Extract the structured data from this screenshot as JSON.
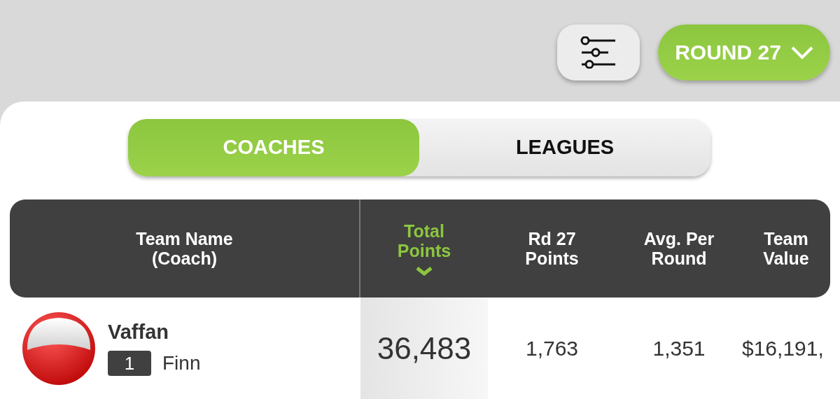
{
  "round_button": {
    "label": "ROUND 27"
  },
  "tabs": [
    {
      "label": "COACHES",
      "selected": true
    },
    {
      "label": "LEAGUES",
      "selected": false
    }
  ],
  "table": {
    "columns": [
      {
        "label": "Team Name (Coach)",
        "sorted": false
      },
      {
        "label": "Total Points",
        "sorted": true
      },
      {
        "label": "Rd 27 Points",
        "sorted": false
      },
      {
        "label": "Avg. Per Round",
        "sorted": false
      },
      {
        "label": "Team Value",
        "sorted": false
      }
    ],
    "rows": [
      {
        "team": "Vaffan",
        "rank": "1",
        "coach": "Finn",
        "total": "36,483",
        "round_points": "1,763",
        "average": "1,351",
        "value": "$16,191,"
      }
    ]
  }
}
